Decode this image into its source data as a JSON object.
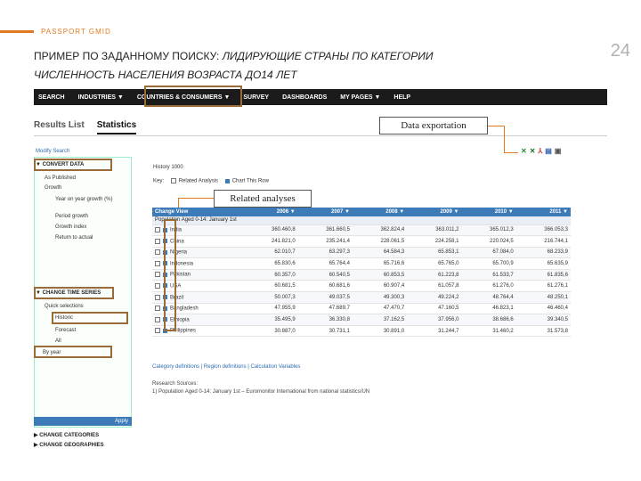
{
  "header": {
    "brand": "PASSPORT GMID",
    "title_line1_plain": "ПРИМЕР ПО ЗАДАННОМУ ПОИСКУ: ",
    "title_line1_italic": "ЛИДИРУЮЩИЕ СТРАНЫ ПО КАТЕГОРИИ",
    "title_line2": "ЧИСЛЕННОСТЬ НАСЕЛЕНИЯ ВОЗРАСТА ДО14 ЛЕТ",
    "slide_number": "24"
  },
  "nav": [
    "SEARCH",
    "INDUSTRIES ▼",
    "COUNTRIES & CONSUMERS ▼",
    "SURVEY",
    "DASHBOARDS",
    "MY PAGES ▼",
    "HELP"
  ],
  "tabs": [
    "Results List",
    "Statistics"
  ],
  "sidebar": {
    "modify_search": "Modify Search",
    "convert_data": "▼ CONVERT DATA",
    "convert_items": [
      "As Published",
      "Growth",
      "Year on year growth (%)",
      "Period growth",
      "Growth index",
      "Return to actual"
    ],
    "change_time_series": "▼ CHANGE TIME SERIES",
    "time_items": [
      "Quick selections",
      "Historic",
      "Forecast",
      "All",
      "By year"
    ],
    "apply": "Apply",
    "bottom_links": [
      "▶ CHANGE CATEGORIES",
      "▶ CHANGE GEOGRAPHIES"
    ]
  },
  "callouts": {
    "data_exportation": "Data exportation",
    "related_analyses": "Related analyses"
  },
  "content": {
    "history_label": "History   1000",
    "key_label": "Key:",
    "key_related": "Related Analysis",
    "key_chart": "Chart This Row"
  },
  "table": {
    "header_first": "Change View",
    "years": [
      "2006 ▼",
      "2007 ▼",
      "2008 ▼",
      "2009 ▼",
      "2010 ▼",
      "2011 ▼"
    ],
    "subheader": "Population Aged 0-14: January 1st",
    "rows": [
      {
        "country": "India",
        "values": [
          "360.460,8",
          "361.660,5",
          "362.824,4",
          "363.011,2",
          "365.012,3",
          "366.053,3"
        ]
      },
      {
        "country": "China",
        "values": [
          "241.821,0",
          "235.241,4",
          "228.061,5",
          "224.258,1",
          "220.024,5",
          "216.744,1"
        ]
      },
      {
        "country": "Nigeria",
        "values": [
          "62.010,7",
          "63.297,3",
          "64.584,3",
          "65.853,1",
          "67.084,0",
          "68.233,9"
        ]
      },
      {
        "country": "Indonesia",
        "values": [
          "65.830,6",
          "65.764,4",
          "65.716,6",
          "65.765,0",
          "65.700,9",
          "65.635,9"
        ]
      },
      {
        "country": "Pakistan",
        "values": [
          "60.357,0",
          "60.540,5",
          "60.853,5",
          "61.223,8",
          "61.533,7",
          "61.835,6"
        ]
      },
      {
        "country": "USA",
        "values": [
          "60.681,5",
          "60.681,6",
          "60.907,4",
          "61.057,8",
          "61.276,0",
          "61.276,1"
        ]
      },
      {
        "country": "Brazil",
        "values": [
          "50.007,3",
          "49.037,5",
          "49.300,3",
          "49.224,2",
          "48.764,4",
          "48.250,1"
        ]
      },
      {
        "country": "Bangladesh",
        "values": [
          "47.955,9",
          "47.689,7",
          "47.470,7",
          "47.160,5",
          "46.823,1",
          "46.460,4"
        ]
      },
      {
        "country": "Ethiopia",
        "values": [
          "35.495,9",
          "36.330,8",
          "37.162,5",
          "37.956,0",
          "38.686,6",
          "39.340,5"
        ]
      },
      {
        "country": "Philippines",
        "values": [
          "30.887,0",
          "30.731,1",
          "30.891,0",
          "31.244,7",
          "31.460,2",
          "31.573,8"
        ]
      }
    ]
  },
  "footer": {
    "links": "Category definitions | Region definitions | Calculation Variables",
    "research_title": "Research Sources:",
    "research_text": "1) Population Aged 0-14: January 1st – Euromonitor International from national statistics/UN"
  },
  "colors": {
    "accent": "#e07a1f",
    "table_header": "#3c7bb7",
    "highlight_box": "#9a6a38"
  }
}
